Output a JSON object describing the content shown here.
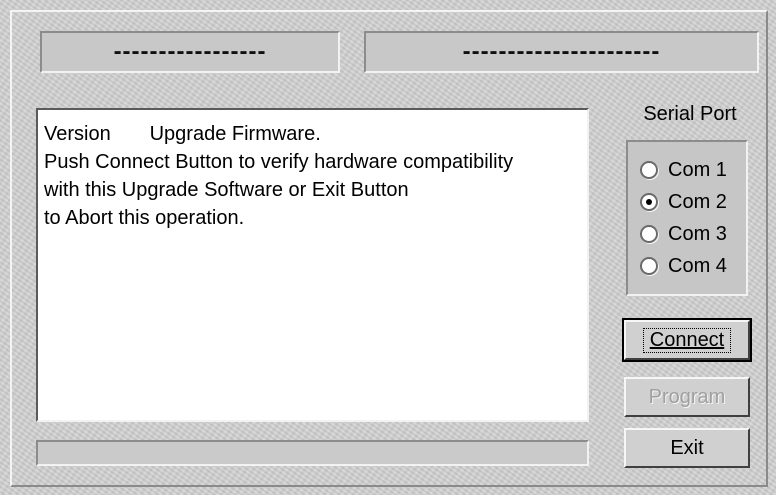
{
  "status": {
    "left_text": "-----------------",
    "right_text": "----------------------"
  },
  "message": {
    "lines": [
      "Version       Upgrade Firmware.",
      "",
      "Push Connect Button to verify hardware compatibility",
      "with this Upgrade Software or Exit Button",
      "to Abort this operation."
    ]
  },
  "serial_port": {
    "label": "Serial Port",
    "options": [
      "Com 1",
      "Com 2",
      "Com 3",
      "Com 4"
    ],
    "selected": "Com 2"
  },
  "buttons": {
    "connect": "Connect",
    "program": "Program",
    "exit": "Exit"
  },
  "progress": {
    "value": 0
  }
}
